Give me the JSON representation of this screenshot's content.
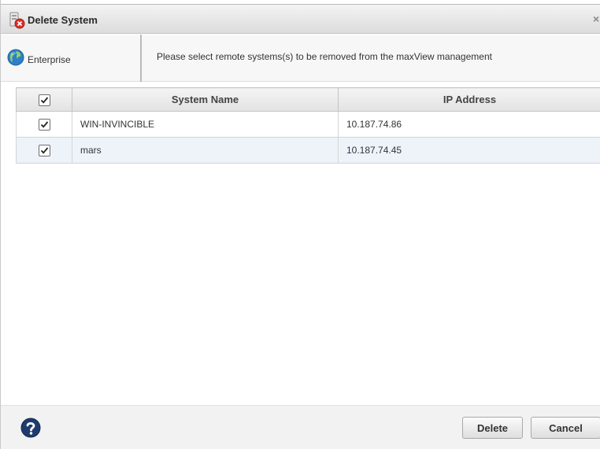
{
  "dialog": {
    "title": "Delete System",
    "close_glyph": "×",
    "title_icon": "delete-system-icon",
    "colors": {
      "titlebar": "#dcdcdc",
      "row_alt": "#eef3fa",
      "icon_red": "#d9302c",
      "globe_blue": "#2e7fc8"
    }
  },
  "info": {
    "scope_label": "Enterprise",
    "scope_icon": "globe-icon",
    "message": "Please select remote systems(s) to be removed from the maxView management"
  },
  "table": {
    "headers": {
      "select_all_checked": true,
      "system_name": "System Name",
      "ip_address": "IP Address"
    },
    "rows": [
      {
        "checked": true,
        "system_name": "WIN-INVINCIBLE",
        "ip_address": "10.187.74.86"
      },
      {
        "checked": true,
        "system_name": "mars",
        "ip_address": "10.187.74.45"
      }
    ]
  },
  "footer": {
    "help_icon": "help-icon",
    "delete_label": "Delete",
    "cancel_label": "Cancel"
  }
}
